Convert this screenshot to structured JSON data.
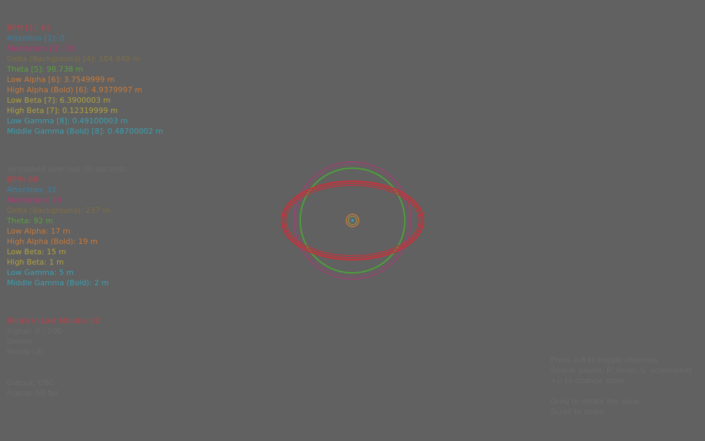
{
  "colors": {
    "background": "#616161",
    "blink": "#b8434d",
    "attention": "#3e7f9f",
    "meditation": "#b03a74",
    "delta": "#7f6e45",
    "theta": "#5aa03d",
    "low_alpha": "#c87a3a",
    "high_alpha": "#c87a3a",
    "low_beta": "#b1a13e",
    "high_beta": "#b1a13e",
    "low_gamma": "#3aa0b0",
    "mid_gamma": "#3aa0b0",
    "faint": "#6b6b6b"
  },
  "raw_panel": {
    "rows": [
      {
        "label": "BPM [1]: 62",
        "color_key": "blink"
      },
      {
        "label": "Attention [2]: 0",
        "color_key": "attention"
      },
      {
        "label": "Meditation [3]: 38",
        "color_key": "meditation"
      },
      {
        "label": "Delta (Background) [4]: 104.949 m",
        "color_key": "delta"
      },
      {
        "label": "Theta [5]: 98.738 m",
        "color_key": "theta"
      },
      {
        "label": "Low Alpha [6]: 3.7549999 m",
        "color_key": "low_alpha"
      },
      {
        "label": "High Alpha (Bold) [6]: 4.9379997 m",
        "color_key": "high_alpha"
      },
      {
        "label": "Low Beta [7]: 6.3900003 m",
        "color_key": "low_beta"
      },
      {
        "label": "High Beta [7]: 0.12319999 m",
        "color_key": "high_beta"
      },
      {
        "label": "Low Gamma [8]: 0.49100003 m",
        "color_key": "low_gamma"
      },
      {
        "label": "Middle Gamma (Bold) [8]: 0.48700002 m",
        "color_key": "mid_gamma"
      }
    ]
  },
  "smoothed_panel": {
    "header": "Smoothed over last 30 seconds",
    "rows": [
      {
        "label": "BPM: 68",
        "color_key": "blink"
      },
      {
        "label": "Attention: 31",
        "color_key": "attention"
      },
      {
        "label": "Meditation: 70",
        "color_key": "meditation"
      },
      {
        "label": "Delta (Background): 237 m",
        "color_key": "delta"
      },
      {
        "label": "Theta: 92 m",
        "color_key": "theta"
      },
      {
        "label": "Low Alpha: 17 m",
        "color_key": "low_alpha"
      },
      {
        "label": "High Alpha (Bold): 19 m",
        "color_key": "high_alpha"
      },
      {
        "label": "Low Beta: 15 m",
        "color_key": "low_beta"
      },
      {
        "label": "High Beta: 1 m",
        "color_key": "high_beta"
      },
      {
        "label": "Low Gamma: 5 m",
        "color_key": "low_gamma"
      },
      {
        "label": "Middle Gamma (Bold): 2 m",
        "color_key": "mid_gamma"
      }
    ]
  },
  "blink_panel": {
    "blinks_label": "Blinks in Last Minute: 32",
    "faint_rows": [
      "Signal: 0 / 200",
      "Sensor",
      "Ready (3)",
      "",
      "",
      "Output: OSC",
      "Frame: 60 fps"
    ]
  },
  "corner_panel": {
    "faint_rows": [
      "Press 1-8 to toggle channels",
      "Space: pause, R: reset, S: screenshot",
      "+/- to change scale",
      "",
      "Drag to rotate the view",
      "Scroll to zoom"
    ]
  }
}
